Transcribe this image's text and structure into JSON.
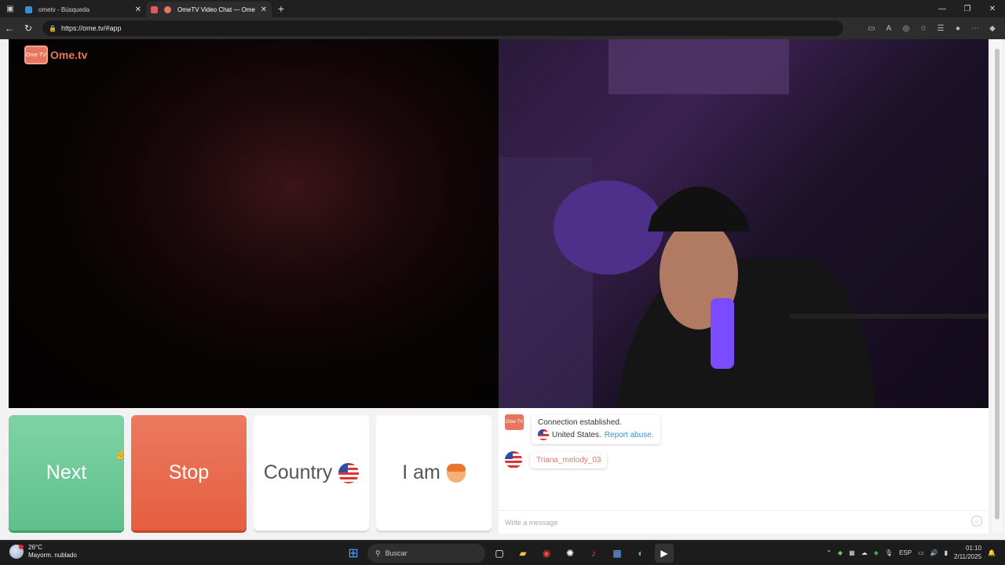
{
  "browser": {
    "tabs": [
      {
        "title": "ometv - Búsqueda",
        "active": false
      },
      {
        "title": "OmeTV Video Chat — Ome",
        "active": true
      }
    ],
    "url": "https://ome.tv/#app"
  },
  "app": {
    "logo_text": "Ome.tv",
    "logo_badge": "Ome TV",
    "buttons": {
      "next": "Next",
      "stop": "Stop",
      "country": "Country",
      "iam": "I am"
    },
    "chat": {
      "system_message": "Connection established.",
      "location": "United States.",
      "report_link": "Report abuse.",
      "username": "Triana_melody_03",
      "input_placeholder": "Write a message"
    }
  },
  "taskbar": {
    "weather_temp": "26°C",
    "weather_desc": "Mayorm. nublado",
    "search_label": "Buscar",
    "language": "ESP",
    "time": "01:10",
    "date": "2/11/2025"
  },
  "colors": {
    "next": "#6fcb98",
    "stop": "#e86a4d",
    "brand": "#e8765f"
  }
}
